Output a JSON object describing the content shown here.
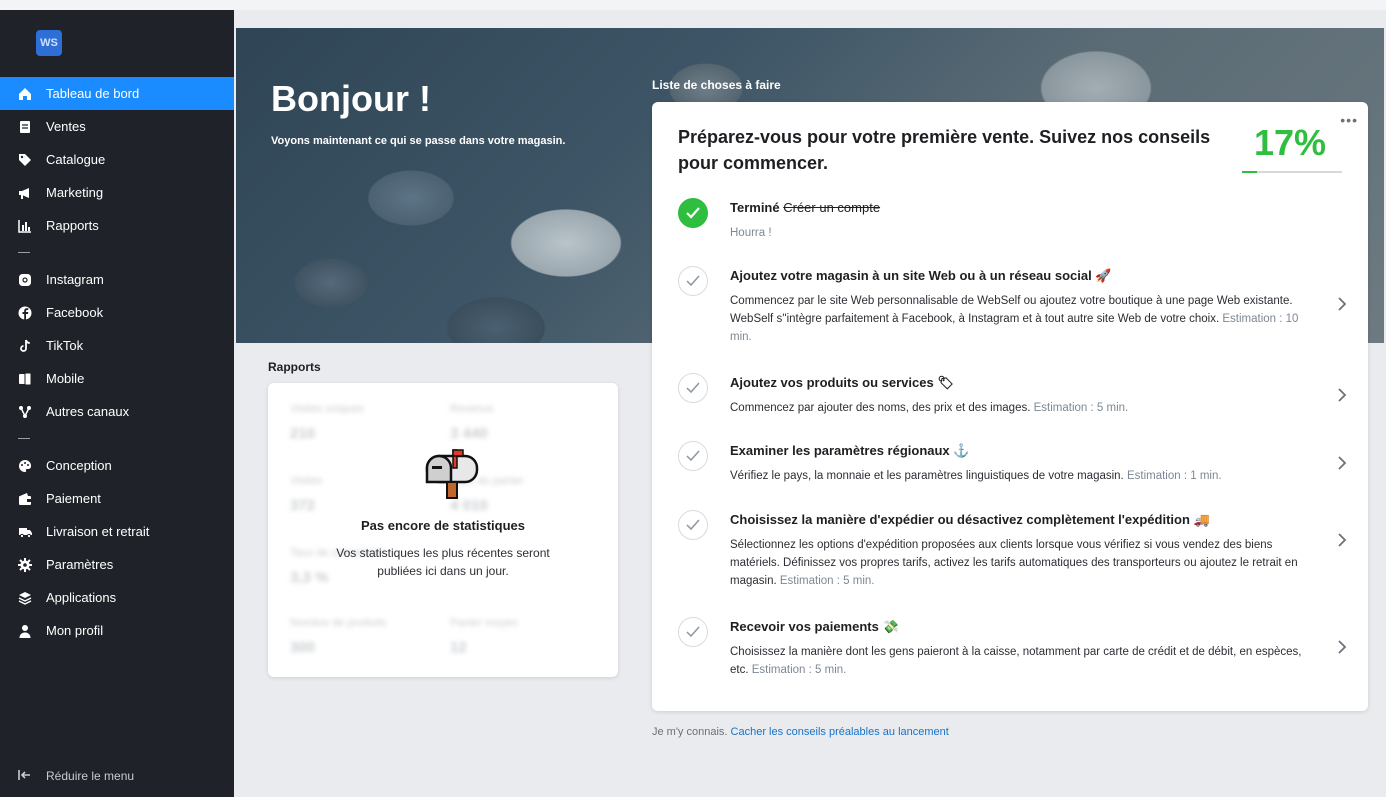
{
  "sidebar": {
    "logo_text": "WS",
    "groups": [
      [
        {
          "label": "Tableau de bord",
          "icon": "home-icon",
          "active": true
        },
        {
          "label": "Ventes",
          "icon": "receipt-icon"
        },
        {
          "label": "Catalogue",
          "icon": "tag-icon"
        },
        {
          "label": "Marketing",
          "icon": "megaphone-icon"
        },
        {
          "label": "Rapports",
          "icon": "bar-chart-icon"
        }
      ],
      [
        {
          "label": "Instagram",
          "icon": "instagram-icon"
        },
        {
          "label": "Facebook",
          "icon": "facebook-icon"
        },
        {
          "label": "TikTok",
          "icon": "tiktok-icon"
        },
        {
          "label": "Mobile",
          "icon": "mobile-icon"
        },
        {
          "label": "Autres canaux",
          "icon": "share-icon"
        }
      ],
      [
        {
          "label": "Conception",
          "icon": "palette-icon"
        },
        {
          "label": "Paiement",
          "icon": "wallet-icon"
        },
        {
          "label": "Livraison et retrait",
          "icon": "truck-icon"
        },
        {
          "label": "Paramètres",
          "icon": "gear-icon"
        },
        {
          "label": "Applications",
          "icon": "layers-icon"
        },
        {
          "label": "Mon profil",
          "icon": "user-icon"
        }
      ]
    ],
    "collapse_label": "Réduire le menu"
  },
  "hero": {
    "title": "Bonjour !",
    "subtitle": "Voyons maintenant ce qui se passe dans votre magasin."
  },
  "reports": {
    "section_label": "Rapports",
    "empty_title": "Pas encore de statistiques",
    "empty_text": "Vos statistiques les plus récentes seront publiées ici dans un jour."
  },
  "todo": {
    "section_label": "Liste de choses à faire",
    "heading": "Préparez-vous pour votre première vente. Suivez nos conseils pour commencer.",
    "progress_label": "17%",
    "progress_fraction": 0.17,
    "tasks": [
      {
        "status_prefix": "Terminé",
        "title": "Créer un compte",
        "done": true,
        "desc": "",
        "estimate": "Hourra !"
      },
      {
        "title": "Ajoutez votre magasin à un site Web ou à un réseau social 🚀",
        "done": false,
        "desc": "Commencez par le site Web personnalisable de WebSelf ou ajoutez votre boutique à une page Web existante. WebSelf s''intègre parfaitement à Facebook, à Instagram et à tout autre site Web de votre choix.",
        "estimate": "Estimation : 10 min."
      },
      {
        "title": "Ajoutez vos produits ou services 🏷",
        "done": false,
        "desc": "Commencez par ajouter des noms, des prix et des images.",
        "estimate": "Estimation : 5 min."
      },
      {
        "title": "Examiner les paramètres régionaux ⚓",
        "done": false,
        "desc": "Vérifiez le pays, la monnaie et les paramètres linguistiques de votre magasin.",
        "estimate": "Estimation : 1 min."
      },
      {
        "title": "Choisissez la manière d'expédier ou désactivez complètement l'expédition 🚚",
        "done": false,
        "desc": "Sélectionnez les options d'expédition proposées aux clients lorsque vous vérifiez si vous vendez des biens matériels. Définissez vos propres tarifs, activez les tarifs automatiques des transporteurs ou ajoutez le retrait en magasin.",
        "estimate": "Estimation : 5 min."
      },
      {
        "title": "Recevoir vos paiements 💸",
        "done": false,
        "desc": "Choisissez la manière dont les gens paieront à la caisse, notamment par carte de crédit et de débit, en espèces, etc.",
        "estimate": "Estimation : 5 min."
      }
    ]
  },
  "footer": {
    "text": "Je m'y connais.",
    "link": "Cacher les conseils préalables au lancement"
  },
  "colors": {
    "accent": "#1a8cff",
    "success": "#2fbe3f",
    "sidebar_bg": "#1f2329"
  }
}
